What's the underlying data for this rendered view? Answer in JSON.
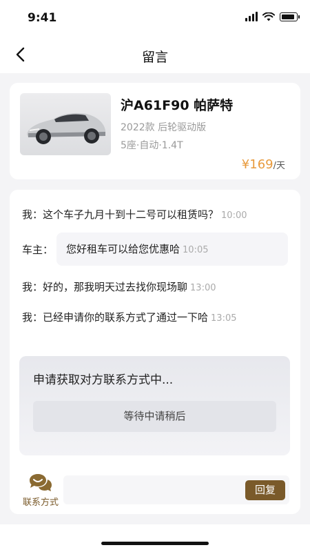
{
  "status": {
    "time": "9:41"
  },
  "nav": {
    "title": "留言"
  },
  "car": {
    "plate_model": "沪A61F90  帕萨特",
    "spec1": "2022款 后轮驱动版",
    "spec2": "5座·自动·1.4T",
    "price": "¥169",
    "unit": "/天"
  },
  "messages": [
    {
      "speaker": "我：",
      "text": "这个车子九月十到十二号可以租赁吗？",
      "time": "10:00"
    },
    {
      "speaker": "车主：",
      "text": "您好租车可以给您优惠哈",
      "time": "10:05"
    },
    {
      "speaker": "我：",
      "text": "好的，那我明天过去找你现场聊",
      "time": "13:00"
    },
    {
      "speaker": "我：",
      "text": "已经申请你的联系方式了通过一下哈",
      "time": "13:05"
    }
  ],
  "request": {
    "title": "申请获取对方联系方式中...",
    "button": "等待中请稍后"
  },
  "footer": {
    "contact_label": "联系方式",
    "reply_label": "回复"
  },
  "colors": {
    "accent": "#7a5a2a",
    "price": "#e89a3c"
  }
}
